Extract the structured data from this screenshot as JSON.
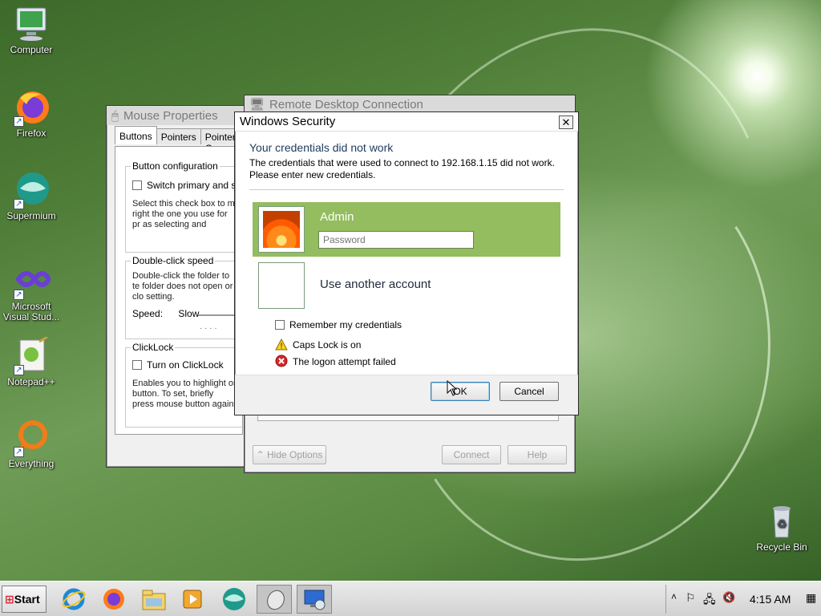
{
  "desktop": {
    "icons": [
      {
        "label": "Computer"
      },
      {
        "label": "Firefox"
      },
      {
        "label": "Supermium"
      },
      {
        "label": "Microsoft Visual Stud..."
      },
      {
        "label": "Notepad++"
      },
      {
        "label": "Everything"
      },
      {
        "label": "Recycle Bin"
      }
    ]
  },
  "mouse_properties": {
    "title": "Mouse Properties",
    "tabs": [
      "Buttons",
      "Pointers",
      "Pointer O"
    ],
    "button_config": {
      "group": "Button configuration",
      "checkbox": "Switch primary and sec",
      "desc": "Select this check box to m right the one you use for pr as selecting and dragging."
    },
    "double_click": {
      "group": "Double-click speed",
      "desc": "Double-click the folder to te folder does not open or clo setting.",
      "speed_label": "Speed:",
      "slow_label": "Slow"
    },
    "clicklock": {
      "group": "ClickLock",
      "checkbox": "Turn on ClickLock",
      "desc": "Enables you to highlight or button. To set, briefly press mouse button again."
    }
  },
  "rdc": {
    "title": "Remote Desktop Connection",
    "hide_options": "Hide Options",
    "connect": "Connect",
    "help": "Help"
  },
  "security": {
    "title": "Windows Security",
    "close": "✕",
    "heading": "Your credentials did not work",
    "message": "The credentials that were used to connect to 192.168.1.15 did not work. Please enter new credentials.",
    "account_name": "Admin",
    "password_placeholder": "Password",
    "other_account": "Use another account",
    "remember": "Remember my credentials",
    "caps_lock": "Caps Lock is on",
    "logon_failed": "The logon attempt failed",
    "ok": "OK",
    "cancel": "Cancel",
    "selected_tile_color": "#93bd5e"
  },
  "taskbar": {
    "start": "Start",
    "clock": "4:15 AM",
    "pinned": [
      "internet-explorer-icon",
      "firefox-icon",
      "file-explorer-icon",
      "media-player-icon",
      "supermium-icon",
      "mouse-icon",
      "remote-desktop-icon"
    ]
  }
}
